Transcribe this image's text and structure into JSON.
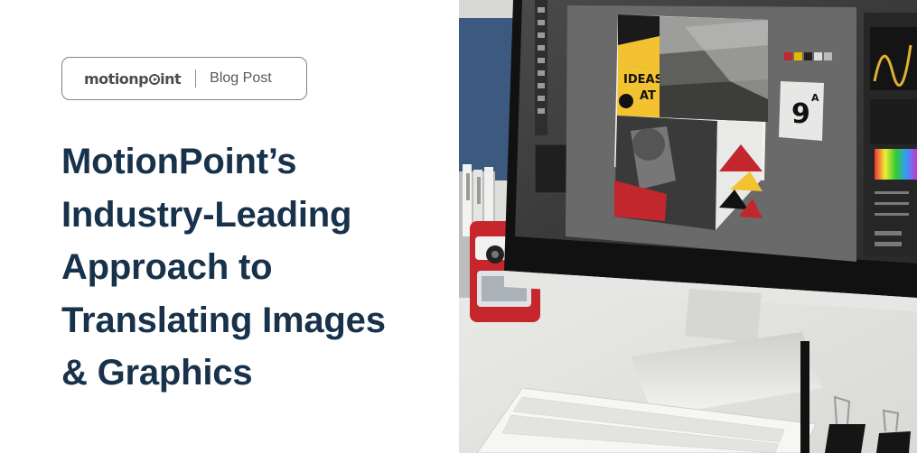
{
  "brand": {
    "logo_text_before": "motionp",
    "logo_text_after": "int",
    "category": "Blog Post"
  },
  "headline": {
    "lines": [
      "MotionPoint’s",
      "Industry-Leading",
      "Approach to",
      "Translating Images",
      "& Graphics"
    ]
  },
  "photo": {
    "poster_text_1": "IDEAS",
    "poster_text_2": "AT",
    "poster_number": "9",
    "poster_letter": "A"
  },
  "colors": {
    "headline": "#17324a",
    "pill_border": "#7d8186",
    "accent_red": "#c1272d",
    "accent_yellow": "#f2c230"
  }
}
